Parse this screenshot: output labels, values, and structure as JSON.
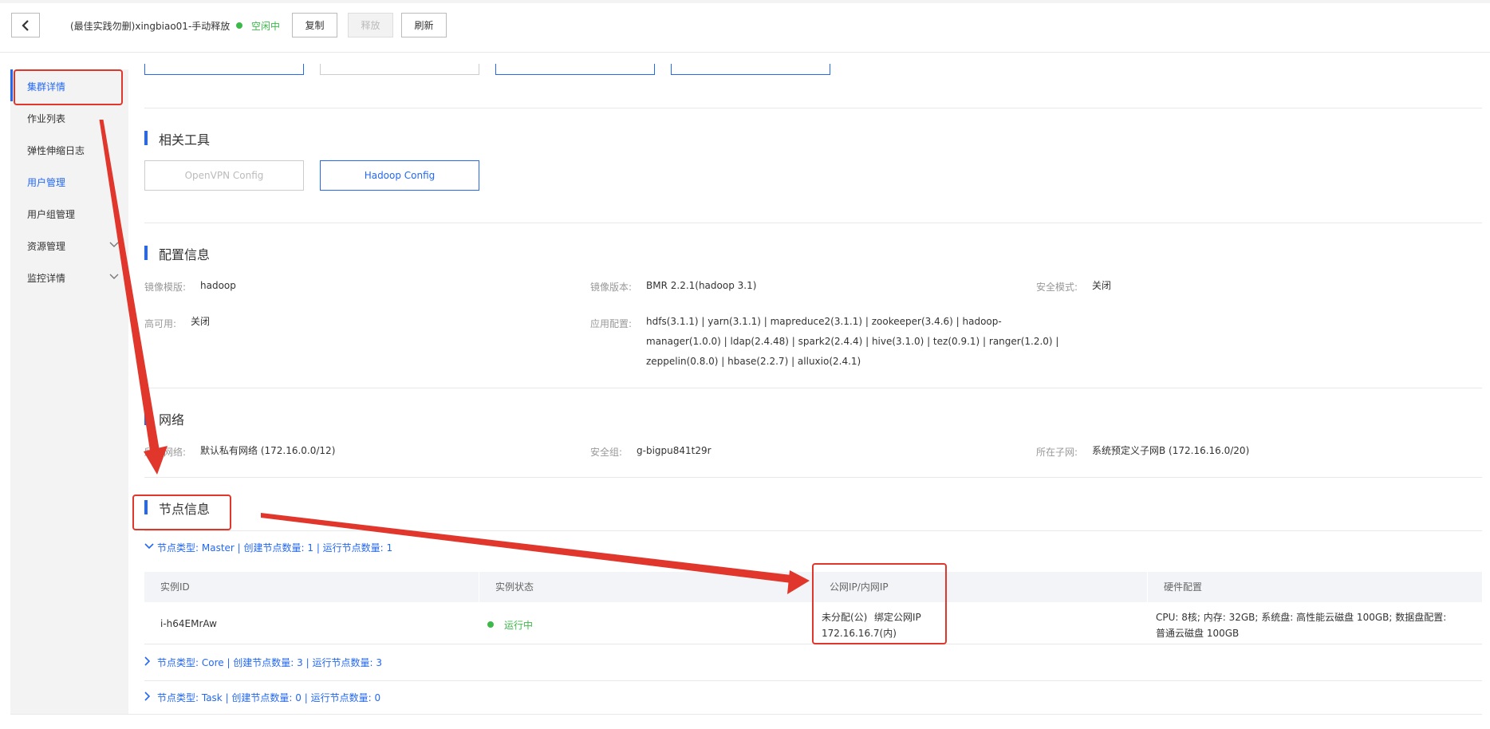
{
  "header": {
    "title": "(最佳实践勿删)xingbiao01-手动释放",
    "status": "空闲中",
    "copy_label": "复制",
    "release_label": "释放",
    "refresh_label": "刷新"
  },
  "sidebar": {
    "items": [
      {
        "label": "集群详情"
      },
      {
        "label": "作业列表"
      },
      {
        "label": "弹性伸缩日志"
      },
      {
        "label": "用户管理"
      },
      {
        "label": "用户组管理"
      },
      {
        "label": "资源管理"
      },
      {
        "label": "监控详情"
      }
    ]
  },
  "tools": {
    "title": "相关工具",
    "openvpn_label": "OpenVPN Config",
    "hadoop_label": "Hadoop Config"
  },
  "config": {
    "title": "配置信息",
    "image_template_label": "镜像模版:",
    "image_template_value": "hadoop",
    "image_version_label": "镜像版本:",
    "image_version_value": "BMR 2.2.1(hadoop 3.1)",
    "security_mode_label": "安全模式:",
    "security_mode_value": "关闭",
    "ha_label": "高可用:",
    "ha_value": "关闭",
    "app_config_label": "应用配置:",
    "app_config_line1": "hdfs(3.1.1) | yarn(3.1.1) | mapreduce2(3.1.1) | zookeeper(3.4.6) | hadoop-",
    "app_config_line2": "manager(1.0.0) | ldap(2.4.48) | spark2(2.4.4) | hive(3.1.0) | tez(0.9.1) | ranger(1.2.0) |",
    "app_config_line3": "zeppelin(0.8.0) | hbase(2.2.7) | alluxio(2.4.1)"
  },
  "network": {
    "title": "网络",
    "vpc_label": "所在网络:",
    "vpc_value": "默认私有网络 (172.16.0.0/12)",
    "sg_label": "安全组:",
    "sg_value": "g-bigpu841t29r",
    "subnet_label": "所在子网:",
    "subnet_value": "系统预定义子网B (172.16.16.0/20)"
  },
  "nodes": {
    "title": "节点信息",
    "master_header": "节点类型: Master | 创建节点数量: 1 | 运行节点数量: 1",
    "core_header": "节点类型: Core | 创建节点数量: 3 | 运行节点数量: 3",
    "task_header": "节点类型: Task | 创建节点数量: 0 | 运行节点数量: 0",
    "columns": [
      "实例ID",
      "实例状态",
      "公网IP/内网IP",
      "硬件配置"
    ],
    "row": {
      "instance_id": "i-h64EMrAw",
      "status": "运行中",
      "public_ip": "未分配(公)",
      "bind_link": "绑定公网IP",
      "private_ip": "172.16.16.7(内)",
      "hardware_line1": "CPU: 8核; 内存: 32GB; 系统盘: 高性能云磁盘 100GB; 数据盘配置:",
      "hardware_line2": "普通云磁盘 100GB"
    }
  },
  "colors": {
    "accent": "#2468f2",
    "success": "#3cb94a",
    "annotation": "#e0362b"
  }
}
